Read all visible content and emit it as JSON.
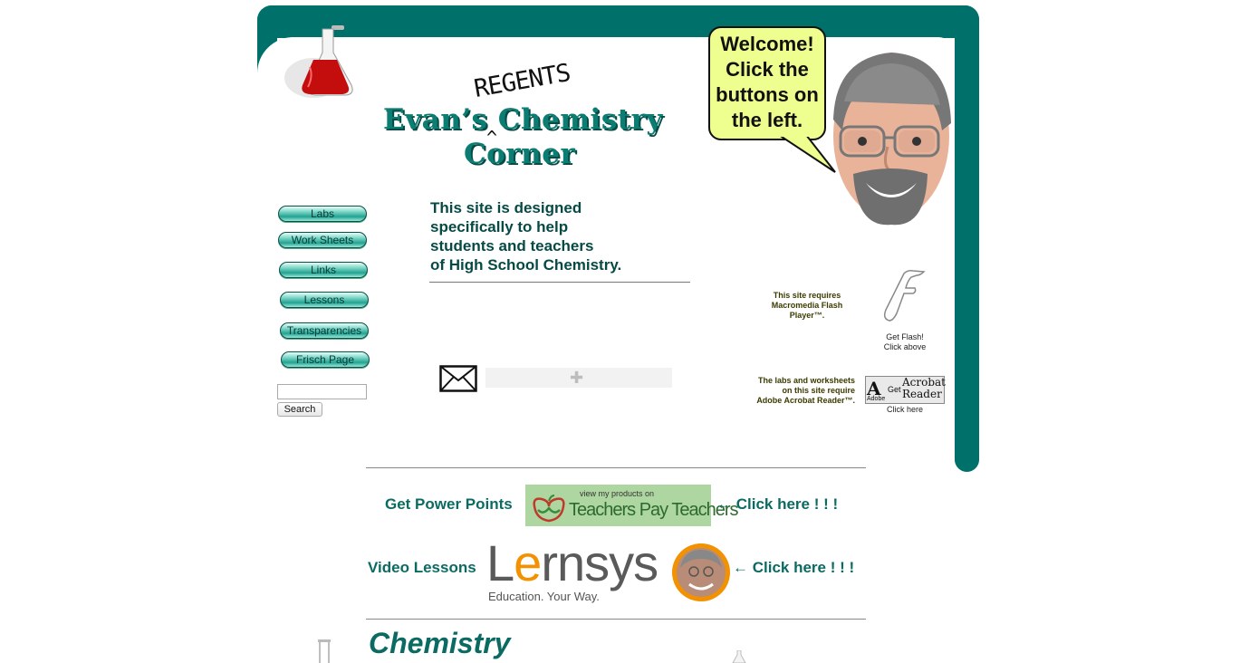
{
  "header": {
    "title_line1": "Evan’s Chemistry",
    "title_line2": "Corner",
    "handwritten_insert": "REGENTS",
    "caret": "^"
  },
  "bubble": {
    "lines": [
      "Welcome!",
      "Click the",
      "buttons on",
      "the left."
    ]
  },
  "nav": {
    "items": [
      {
        "label": "Labs"
      },
      {
        "label": "Work Sheets"
      },
      {
        "label": "Links"
      },
      {
        "label": "Lessons"
      },
      {
        "label": "Transparencies"
      },
      {
        "label": "Frisch Page"
      }
    ]
  },
  "search": {
    "value": "",
    "button_label": "Search"
  },
  "intro": {
    "lines": [
      "This site is designed",
      "specifically to help",
      "students and teachers",
      "of High School Chemistry."
    ]
  },
  "requirements": {
    "flash_note_lines": [
      "This site requires",
      "Macromedia Flash",
      "Player™."
    ],
    "flash_caption_lines": [
      "Get Flash!",
      "Click above"
    ],
    "acrobat_note_lines": [
      "The labs and worksheets",
      "on this site require",
      "Adobe Acrobat Reader™."
    ],
    "acrobat_logo": {
      "adobe": "Adobe",
      "get": "Get",
      "name_line1": "Acrobat",
      "name_line2": "Reader"
    },
    "acrobat_caption": "Click here"
  },
  "promos": {
    "power_points_label": "Get Power Points",
    "tpt_small": "view my products on",
    "tpt_big": "Teachers Pay Teachers",
    "power_points_click": "← Click here ! ! !",
    "video_label": "Video Lessons",
    "lernsys_logo": "Lernsys",
    "lernsys_tagline": "Education. Your Way.",
    "video_click": "← Click here ! ! !"
  },
  "section_heading": "Chemistry",
  "colors": {
    "teal_frame": "#00706a",
    "title_teal": "#0b7d73",
    "bubble_yellow": "#efff8f",
    "lernsys_orange": "#f39200"
  },
  "icons": [
    "flask-icon",
    "envelope-icon",
    "puzzle-icon",
    "flash-icon",
    "acrobat-icon",
    "apple-icon",
    "test-tube-icon"
  ]
}
